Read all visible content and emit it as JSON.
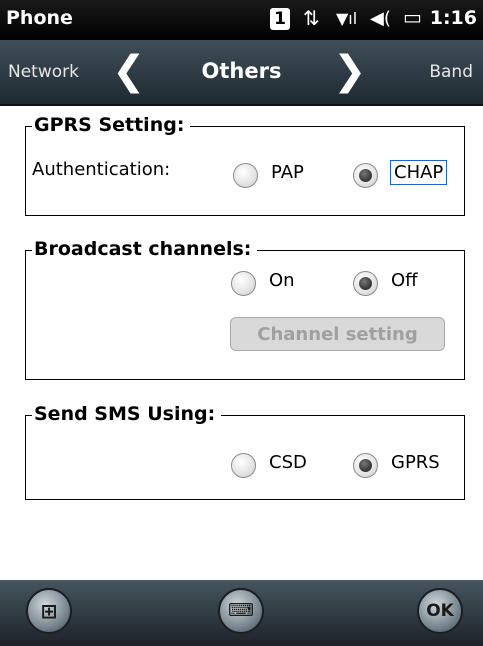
{
  "status_bar": {
    "app_name": "Phone",
    "badge": "1",
    "data_icon": "⇅",
    "signal_icon": "▼ıl",
    "volume_icon": "◀(",
    "battery_icon": "▭",
    "time": "1:16"
  },
  "header": {
    "prev_label": "Network",
    "prev_arrow": "❮",
    "title": "Others",
    "next_arrow": "❯",
    "next_label": "Band"
  },
  "gprs": {
    "legend": "GPRS Setting:",
    "label": "Authentication:",
    "options": [
      "PAP",
      "CHAP"
    ],
    "selected": "CHAP"
  },
  "broadcast": {
    "legend": "Broadcast channels:",
    "options": [
      "On",
      "Off"
    ],
    "selected": "Off",
    "button_label": "Channel setting"
  },
  "sms": {
    "legend": "Send SMS Using:",
    "options": [
      "CSD",
      "GPRS"
    ],
    "selected": "GPRS"
  },
  "bottom_bar": {
    "start_icon": "⊞",
    "keyboard_icon": "⌨",
    "ok_label": "OK"
  }
}
